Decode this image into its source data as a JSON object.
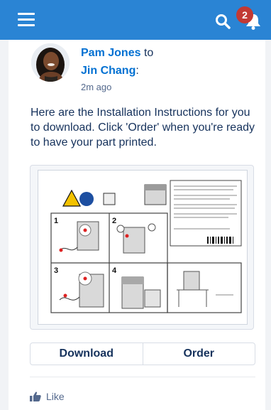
{
  "header": {
    "notification_count": "2",
    "icons": [
      "hamburger-menu-icon",
      "search-icon",
      "bell-icon"
    ],
    "background_color": "#2a84d4"
  },
  "post": {
    "author": "Pam Jones",
    "connector": "to",
    "recipient": "Jin Chang",
    "recipient_suffix": ":",
    "timestamp": "2m ago",
    "body": "Here are the Installation Instructions for you to download. Click 'Order' when you're ready to have your part printed."
  },
  "attachment": {
    "panel_numbers": [
      "1",
      "2",
      "3",
      "4"
    ]
  },
  "actions": {
    "download_label": "Download",
    "order_label": "Order"
  },
  "footer": {
    "like_label": "Like"
  }
}
